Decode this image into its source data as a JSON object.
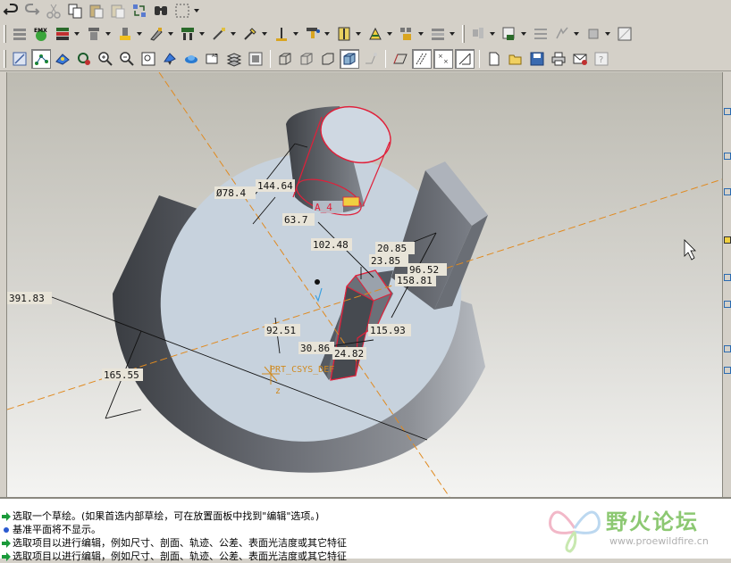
{
  "toolbar": {
    "row1": [
      "undo-icon",
      "redo-icon",
      "cut-icon",
      "copy-icon",
      "paste-icon",
      "paste-special-icon",
      "regenerate-icon",
      "find-icon",
      "select-box-icon"
    ],
    "row2": [
      "sketch-icon",
      "emx-icon",
      "layer-icon",
      "extrude-tool-icon",
      "hole-icon",
      "round-icon",
      "chamfer-icon",
      "rib-icon",
      "draft-icon",
      "datum-axis-icon",
      "datum-point-icon",
      "coordinate-system-icon",
      "shell-icon",
      "pattern-icon",
      "mirror-icon",
      "annotation-icon",
      "analysis-icon",
      "model-tree-icon",
      "cable-icon",
      "mold-icon",
      "render-icon"
    ],
    "row3": [
      "sketcher-display-icon",
      "select-dimension-icon",
      "spin-center-icon",
      "reorient-icon",
      "zoom-in-icon",
      "zoom-out-icon",
      "refit-icon",
      "pan-icon",
      "repaint-icon",
      "saved-views-icon",
      "layers-icon",
      "wireframe-icon",
      "hidden-line-icon",
      "no-hidden-icon",
      "shading-icon",
      "appearance-icon",
      "datum-planes-icon",
      "datum-axes-icon",
      "datum-points-icon",
      "datum-csys-icon",
      "new-file-icon",
      "open-file-icon",
      "save-icon",
      "print-icon",
      "email-icon",
      "context-help-icon"
    ],
    "emx_label": "EMX"
  },
  "dimensions": {
    "d_cyl_diameter": "Ø78.4",
    "d_cyl_top": "144.64",
    "d_cyl_base": "63.7",
    "d_a4": "A_4",
    "d_dist": "102.48",
    "d_block_w": "20.85",
    "d_block_w2": "23.85",
    "d_block_h": "96.52",
    "d_block_d": "158.81",
    "d_base_dia": "391.83",
    "d_base_h": "165.55",
    "d_pocket_depth": "92.51",
    "d_pocket_w": "115.93",
    "d_pocket_a": "30.86",
    "d_pocket_b": "24.82",
    "csys_label": "PRT_CSYS_DEF",
    "axis_z": "z"
  },
  "messages": [
    {
      "icon": "arrow-diamond-icon",
      "text": "选取一个草绘。(如果首选内部草绘，可在放置面板中找到\"编辑\"选项。)"
    },
    {
      "icon": "info-dot-icon",
      "text": "基准平面将不显示。"
    },
    {
      "icon": "arrow-diamond-icon",
      "text": "选取项目以进行编辑，例如尺寸、剖面、轨迹、公差、表面光洁度或其它特征"
    },
    {
      "icon": "arrow-diamond-icon",
      "text": "选取项目以进行编辑，例如尺寸、剖面、轨迹、公差、表面光洁度或其它特征"
    }
  ],
  "watermark": {
    "brand": "野火论坛",
    "url": "www.proewildfire.cn"
  },
  "colors": {
    "viewport_top": "#c4c2ba",
    "viewport_bottom": "#f0f0ee",
    "selection_red": "#e0203a",
    "axis_orange": "#e08a20",
    "dim_label_bg": "#e8e4d8",
    "accent_green": "#8cc872"
  }
}
